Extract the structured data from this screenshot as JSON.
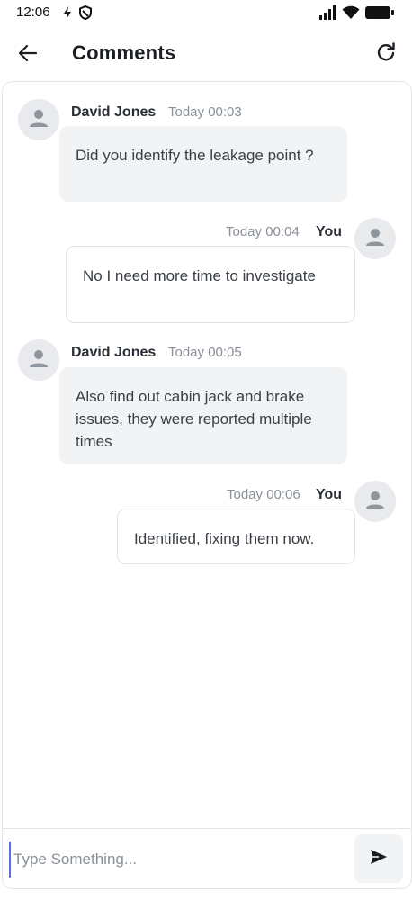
{
  "status_bar": {
    "time": "12:06",
    "icons": [
      "data-saver-icon",
      "shield-icon",
      "signal-icon",
      "wifi-icon",
      "battery-icon"
    ]
  },
  "header": {
    "title": "Comments",
    "back_icon": "arrow-left-icon",
    "refresh_icon": "refresh-icon"
  },
  "messages": [
    {
      "author": "David Jones",
      "time": "Today 00:03",
      "text": "Did you identify the leakage point ?",
      "direction": "incoming",
      "avatar_icon": "person-icon"
    },
    {
      "author": "You",
      "time": "Today 00:04",
      "text": "No I need more time to investigate",
      "direction": "outgoing",
      "avatar_icon": "person-icon"
    },
    {
      "author": "David Jones",
      "time": "Today 00:05",
      "text": "Also find out cabin jack and brake issues, they were reported multiple times",
      "direction": "incoming",
      "avatar_icon": "person-icon"
    },
    {
      "author": "You",
      "time": "Today 00:06",
      "text": "Identified, fixing them now.",
      "direction": "outgoing",
      "avatar_icon": "person-icon"
    }
  ],
  "composer": {
    "placeholder": "Type Something...",
    "value": "",
    "send_icon": "send-icon"
  },
  "colors": {
    "incoming_bubble": "#f1f3f5",
    "outgoing_bubble": "#ffffff",
    "avatar_bg": "#e8eaed",
    "cursor": "#5b6fd6"
  }
}
